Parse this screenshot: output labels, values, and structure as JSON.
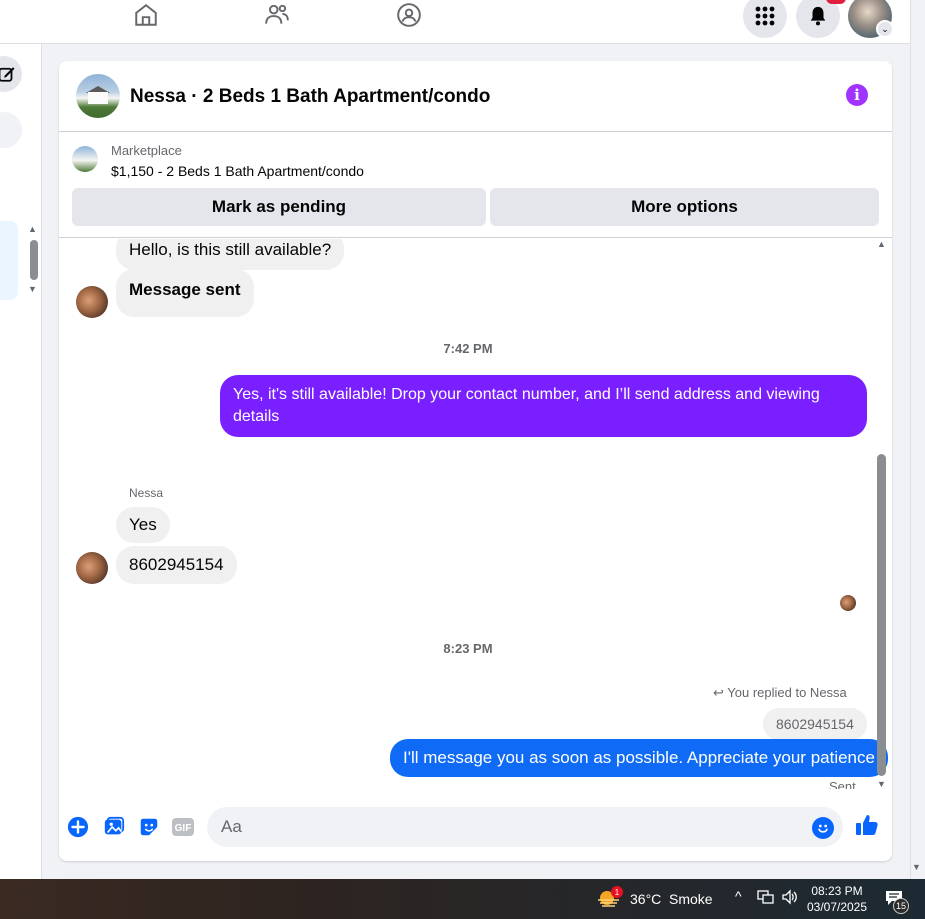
{
  "topnav": {
    "items": [
      {
        "icon": "home-icon"
      },
      {
        "icon": "friends-icon"
      },
      {
        "icon": "groups-icon"
      }
    ],
    "right_icons": [
      "menu-grid-icon",
      "bell-icon",
      "profile-avatar"
    ]
  },
  "chat": {
    "title": "Nessa · 2 Beds 1 Bath Apartment/condo",
    "marketplace_label": "Marketplace",
    "listing": "$1,150 - 2 Beds 1 Bath Apartment/condo",
    "mark_pending_label": "Mark as pending",
    "more_options_label": "More options"
  },
  "messages": {
    "m1": "Hello, is this still available?",
    "m2": "Message sent",
    "time1": "7:42 PM",
    "m3": "Yes, it's still available! Drop your contact number, and I’ll send address and viewing details",
    "sender": "Nessa",
    "m4": "Yes",
    "m5": "8602945154",
    "time2": "8:23 PM",
    "reply_label": "You replied to Nessa",
    "quoted": "8602945154",
    "m6": "I'll message you as soon as possible. Appreciate your patience",
    "sent": "Sent"
  },
  "composer": {
    "placeholder": "Aa"
  },
  "taskbar": {
    "weather_badge": "1",
    "temp": "36°C",
    "condition": "Smoke",
    "time": "08:23 PM",
    "date": "03/07/2025",
    "notif_count": "15"
  },
  "colors": {
    "purple_bubble": "#7a1fff",
    "blue_bubble": "#0f6af5",
    "accent": "#0866ff",
    "info": "#a033ff"
  }
}
